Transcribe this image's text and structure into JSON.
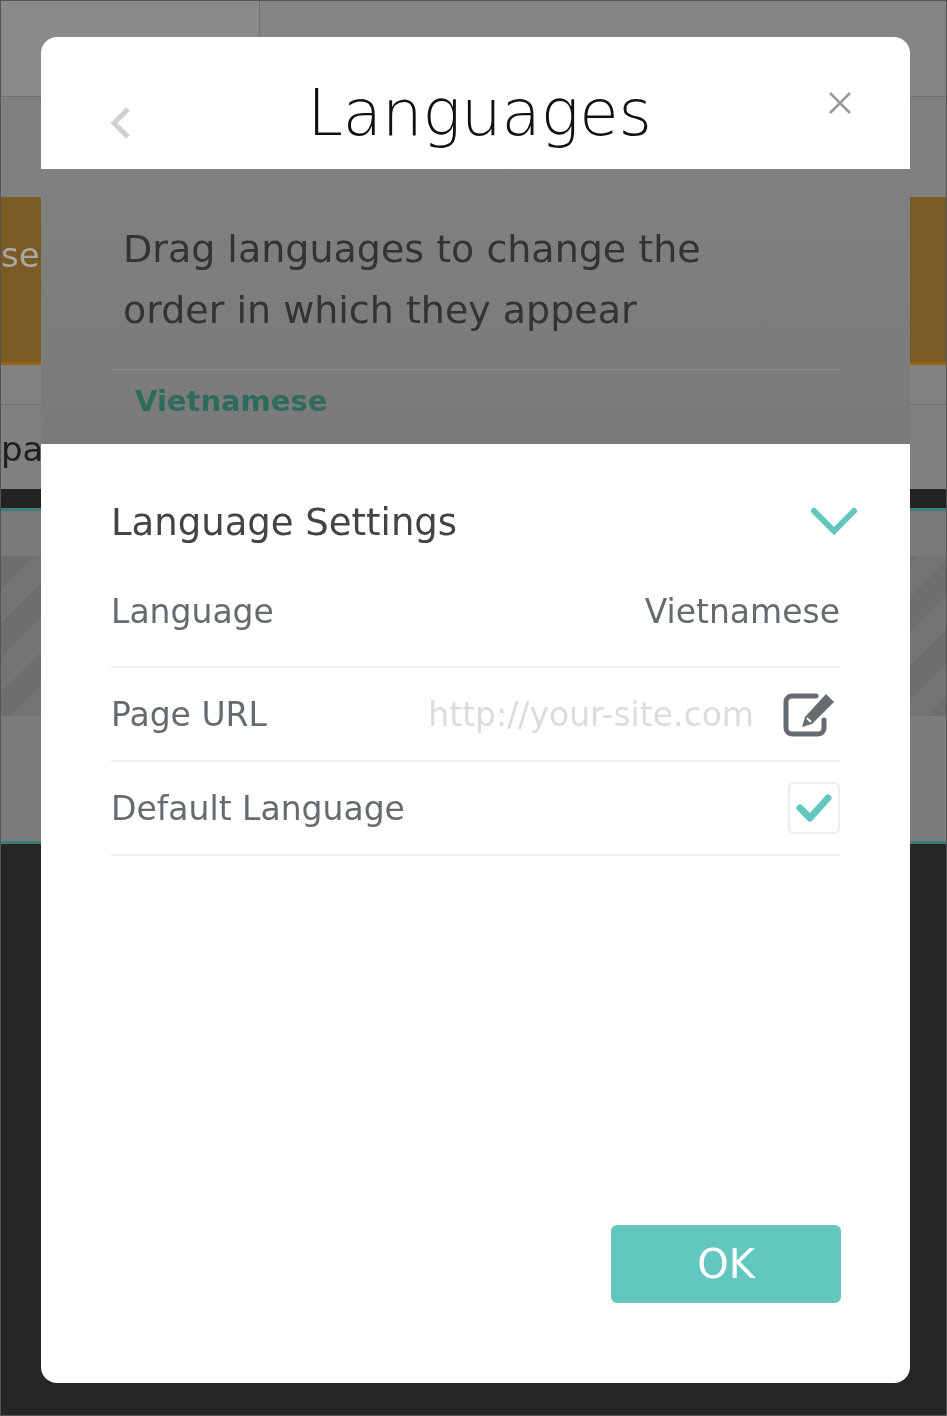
{
  "background": {
    "fragments": [
      {
        "text": "se"
      },
      {
        "text": "pa"
      }
    ]
  },
  "dialog": {
    "title": "Languages",
    "instructions": "Drag languages to change the order in which they appear",
    "languages": [
      {
        "name": "Vietnamese"
      }
    ],
    "settings": {
      "title": "Language Settings",
      "expanded": true,
      "rows": [
        {
          "kind": "value",
          "label": "Language",
          "value": "Vietnamese"
        },
        {
          "kind": "url",
          "label": "Page URL",
          "placeholder": "http://your-site.com"
        },
        {
          "kind": "checkbox",
          "label": "Default Language",
          "checked": true
        }
      ]
    },
    "buttons": [
      {
        "label": "OK"
      }
    ]
  }
}
